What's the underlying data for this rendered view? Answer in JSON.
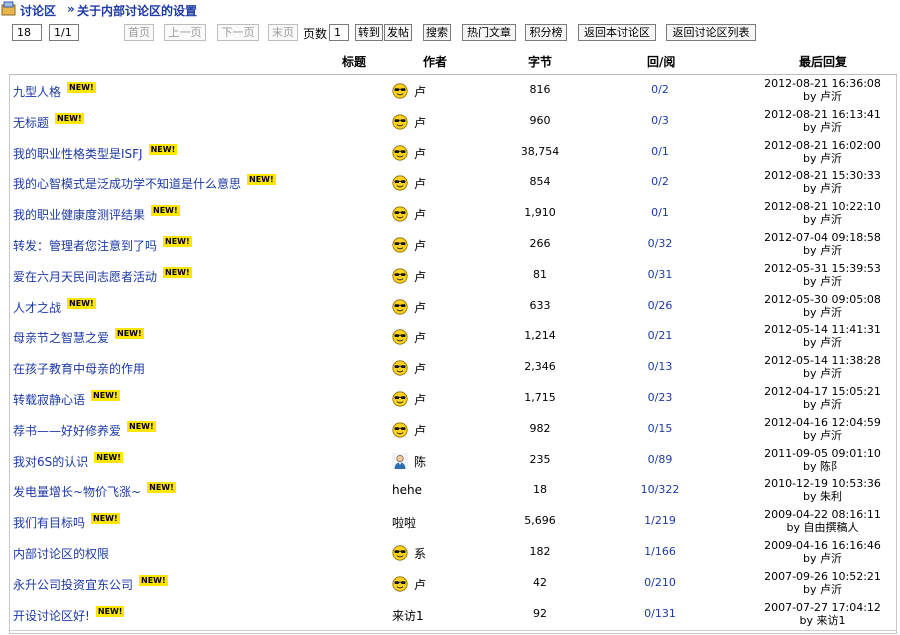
{
  "breadcrumb": {
    "section": "讨论区",
    "separator": "»",
    "current": "关于内部讨论区的设置"
  },
  "toolbar": {
    "count": "18",
    "page_of": "1/1",
    "first": "首页",
    "prev": "上一页",
    "next": "下一页",
    "last": "末页",
    "page_label": "页数",
    "page_value": "1",
    "goto": "转到",
    "post": "发帖",
    "search": "搜索",
    "hot": "热门文章",
    "points": "积分榜",
    "back_board": "返回本讨论区",
    "back_list": "返回讨论区列表"
  },
  "columns": {
    "title": "标题",
    "author": "作者",
    "bytes": "字节",
    "replies": "回/阅",
    "last": "最后回复"
  },
  "new_badge": "NEW!",
  "rows": [
    {
      "title": "九型人格",
      "new": true,
      "icon": "sunglasses-smiley",
      "author": "卢",
      "bytes": "816",
      "replies": "0/2",
      "date": "2012-08-21 16:36:08",
      "by": "by 卢沂"
    },
    {
      "title": "无标题",
      "new": true,
      "icon": "sunglasses-smiley",
      "author": "卢",
      "bytes": "960",
      "replies": "0/3",
      "date": "2012-08-21 16:13:41",
      "by": "by 卢沂"
    },
    {
      "title": "我的职业性格类型是ISFJ",
      "new": true,
      "icon": "sunglasses-smiley",
      "author": "卢",
      "bytes": "38,754",
      "replies": "0/1",
      "date": "2012-08-21 16:02:00",
      "by": "by 卢沂"
    },
    {
      "title": "我的心智模式是泛成功学不知道是什么意思",
      "new": true,
      "icon": "sunglasses-smiley",
      "author": "卢",
      "bytes": "854",
      "replies": "0/2",
      "date": "2012-08-21 15:30:33",
      "by": "by 卢沂"
    },
    {
      "title": "我的职业健康度测评结果",
      "new": true,
      "icon": "sunglasses-smiley",
      "author": "卢",
      "bytes": "1,910",
      "replies": "0/1",
      "date": "2012-08-21 10:22:10",
      "by": "by 卢沂"
    },
    {
      "title": "转发：管理者您注意到了吗",
      "new": true,
      "icon": "sunglasses-smiley",
      "author": "卢",
      "bytes": "266",
      "replies": "0/32",
      "date": "2012-07-04 09:18:58",
      "by": "by 卢沂"
    },
    {
      "title": "爱在六月天民间志愿者活动",
      "new": true,
      "icon": "sunglasses-smiley",
      "author": "卢",
      "bytes": "81",
      "replies": "0/31",
      "date": "2012-05-31 15:39:53",
      "by": "by 卢沂"
    },
    {
      "title": "人才之战",
      "new": true,
      "icon": "sunglasses-smiley",
      "author": "卢",
      "bytes": "633",
      "replies": "0/26",
      "date": "2012-05-30 09:05:08",
      "by": "by 卢沂"
    },
    {
      "title": "母亲节之智慧之爱",
      "new": true,
      "icon": "sunglasses-smiley",
      "author": "卢",
      "bytes": "1,214",
      "replies": "0/21",
      "date": "2012-05-14 11:41:31",
      "by": "by 卢沂"
    },
    {
      "title": "在孩子教育中母亲的作用",
      "new": false,
      "icon": "sunglasses-smiley",
      "author": "卢",
      "bytes": "2,346",
      "replies": "0/13",
      "date": "2012-05-14 11:38:28",
      "by": "by 卢沂"
    },
    {
      "title": "转载寂静心语",
      "new": true,
      "icon": "sunglasses-smiley",
      "author": "卢",
      "bytes": "1,715",
      "replies": "0/23",
      "date": "2012-04-17 15:05:21",
      "by": "by 卢沂"
    },
    {
      "title": "荐书——好好修养爱",
      "new": true,
      "icon": "sunglasses-smiley",
      "author": "卢",
      "bytes": "982",
      "replies": "0/15",
      "date": "2012-04-16 12:04:59",
      "by": "by 卢沂"
    },
    {
      "title": "我对6S的认识",
      "new": true,
      "icon": "person-avatar",
      "author": "陈",
      "bytes": "235",
      "replies": "0/89",
      "date": "2011-09-05 09:01:10",
      "by": "by 陈阝"
    },
    {
      "title": "发电量增长~物价飞涨~",
      "new": true,
      "icon": "",
      "author": "hehe",
      "bytes": "18",
      "replies": "10/322",
      "date": "2010-12-19 10:53:36",
      "by": "by 朱利"
    },
    {
      "title": "我们有目标吗",
      "new": true,
      "icon": "",
      "author": "啦啦",
      "bytes": "5,696",
      "replies": "1/219",
      "date": "2009-04-22 08:16:11",
      "by": "by 自由撰稿人"
    },
    {
      "title": "内部讨论区的权限",
      "new": false,
      "icon": "sunglasses-smiley",
      "author": "系",
      "bytes": "182",
      "replies": "1/166",
      "date": "2009-04-16 16:16:46",
      "by": "by 卢沂"
    },
    {
      "title": "永升公司投资宜东公司",
      "new": true,
      "icon": "sunglasses-smiley",
      "author": "卢",
      "bytes": "42",
      "replies": "0/210",
      "date": "2007-09-26 10:52:21",
      "by": "by 卢沂"
    },
    {
      "title": "开设讨论区好!",
      "new": true,
      "icon": "",
      "author": "来访1",
      "bytes": "92",
      "replies": "0/131",
      "date": "2007-07-27 17:04:12",
      "by": "by 来访1"
    }
  ],
  "colors": {
    "link": "#1d3aa5",
    "badge": "#ffe600",
    "border": "#cfcfcf"
  }
}
